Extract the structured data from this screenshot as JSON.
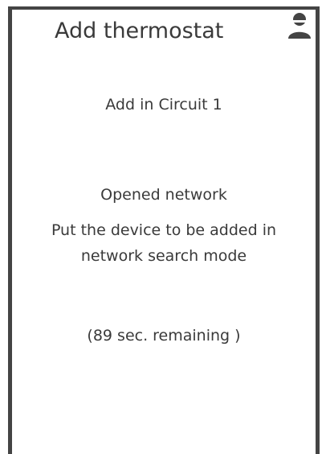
{
  "header": {
    "title": "Add thermostat",
    "user_icon": "user-icon"
  },
  "main": {
    "circuit_text": "Add in Circuit 1",
    "network_status": "Opened network",
    "instruction_line1": "Put the device to be added in",
    "instruction_line2": "network search mode",
    "remaining_text": "(89 sec. remaining )"
  },
  "colors": {
    "frame": "#444444",
    "text": "#3a3a3a",
    "background": "#ffffff"
  }
}
